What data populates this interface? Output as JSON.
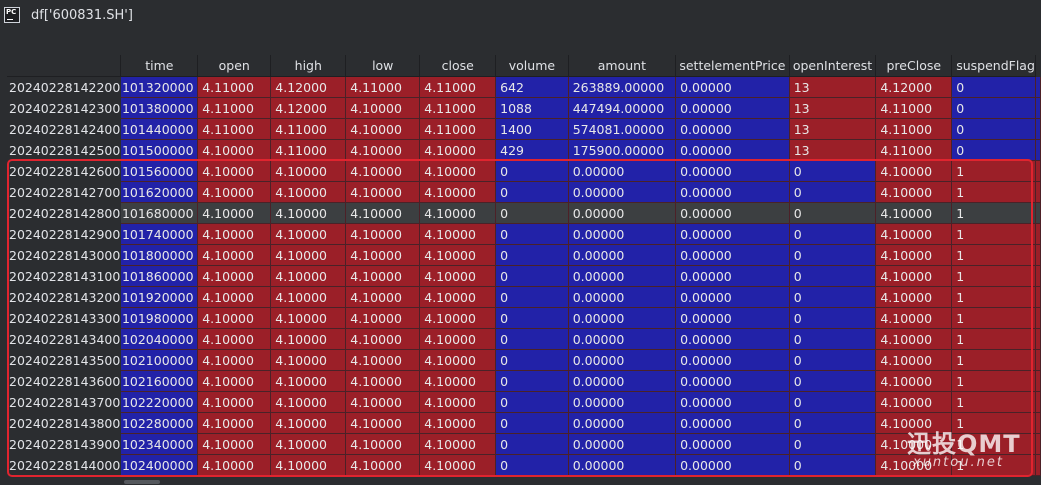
{
  "window": {
    "title": "df['600831.SH']"
  },
  "table": {
    "columns": [
      "time",
      "open",
      "high",
      "low",
      "close",
      "volume",
      "amount",
      "settelementPrice",
      "openInterest",
      "preClose",
      "suspendFlag"
    ],
    "rows": [
      {
        "index": "20240228142200",
        "time": "101320000",
        "open": "4.11000",
        "high": "4.12000",
        "low": "4.11000",
        "close": "4.11000",
        "volume": "642",
        "amount": "263889.00000",
        "settelementPrice": "0.00000",
        "openInterest": "13",
        "preClose": "4.12000",
        "suspendFlag": "0"
      },
      {
        "index": "20240228142300",
        "time": "101380000",
        "open": "4.11000",
        "high": "4.12000",
        "low": "4.10000",
        "close": "4.11000",
        "volume": "1088",
        "amount": "447494.00000",
        "settelementPrice": "0.00000",
        "openInterest": "13",
        "preClose": "4.11000",
        "suspendFlag": "0"
      },
      {
        "index": "20240228142400",
        "time": "101440000",
        "open": "4.11000",
        "high": "4.11000",
        "low": "4.10000",
        "close": "4.11000",
        "volume": "1400",
        "amount": "574081.00000",
        "settelementPrice": "0.00000",
        "openInterest": "13",
        "preClose": "4.11000",
        "suspendFlag": "0"
      },
      {
        "index": "20240228142500",
        "time": "101500000",
        "open": "4.10000",
        "high": "4.11000",
        "low": "4.10000",
        "close": "4.10000",
        "volume": "429",
        "amount": "175900.00000",
        "settelementPrice": "0.00000",
        "openInterest": "13",
        "preClose": "4.11000",
        "suspendFlag": "0"
      },
      {
        "index": "20240228142600",
        "time": "101560000",
        "open": "4.10000",
        "high": "4.10000",
        "low": "4.10000",
        "close": "4.10000",
        "volume": "0",
        "amount": "0.00000",
        "settelementPrice": "0.00000",
        "openInterest": "0",
        "preClose": "4.10000",
        "suspendFlag": "1"
      },
      {
        "index": "20240228142700",
        "time": "101620000",
        "open": "4.10000",
        "high": "4.10000",
        "low": "4.10000",
        "close": "4.10000",
        "volume": "0",
        "amount": "0.00000",
        "settelementPrice": "0.00000",
        "openInterest": "0",
        "preClose": "4.10000",
        "suspendFlag": "1"
      },
      {
        "index": "20240228142800",
        "time": "101680000",
        "open": "4.10000",
        "high": "4.10000",
        "low": "4.10000",
        "close": "4.10000",
        "volume": "0",
        "amount": "0.00000",
        "settelementPrice": "0.00000",
        "openInterest": "0",
        "preClose": "4.10000",
        "suspendFlag": "1",
        "selected": true
      },
      {
        "index": "20240228142900",
        "time": "101740000",
        "open": "4.10000",
        "high": "4.10000",
        "low": "4.10000",
        "close": "4.10000",
        "volume": "0",
        "amount": "0.00000",
        "settelementPrice": "0.00000",
        "openInterest": "0",
        "preClose": "4.10000",
        "suspendFlag": "1"
      },
      {
        "index": "20240228143000",
        "time": "101800000",
        "open": "4.10000",
        "high": "4.10000",
        "low": "4.10000",
        "close": "4.10000",
        "volume": "0",
        "amount": "0.00000",
        "settelementPrice": "0.00000",
        "openInterest": "0",
        "preClose": "4.10000",
        "suspendFlag": "1"
      },
      {
        "index": "20240228143100",
        "time": "101860000",
        "open": "4.10000",
        "high": "4.10000",
        "low": "4.10000",
        "close": "4.10000",
        "volume": "0",
        "amount": "0.00000",
        "settelementPrice": "0.00000",
        "openInterest": "0",
        "preClose": "4.10000",
        "suspendFlag": "1"
      },
      {
        "index": "20240228143200",
        "time": "101920000",
        "open": "4.10000",
        "high": "4.10000",
        "low": "4.10000",
        "close": "4.10000",
        "volume": "0",
        "amount": "0.00000",
        "settelementPrice": "0.00000",
        "openInterest": "0",
        "preClose": "4.10000",
        "suspendFlag": "1"
      },
      {
        "index": "20240228143300",
        "time": "101980000",
        "open": "4.10000",
        "high": "4.10000",
        "low": "4.10000",
        "close": "4.10000",
        "volume": "0",
        "amount": "0.00000",
        "settelementPrice": "0.00000",
        "openInterest": "0",
        "preClose": "4.10000",
        "suspendFlag": "1"
      },
      {
        "index": "20240228143400",
        "time": "102040000",
        "open": "4.10000",
        "high": "4.10000",
        "low": "4.10000",
        "close": "4.10000",
        "volume": "0",
        "amount": "0.00000",
        "settelementPrice": "0.00000",
        "openInterest": "0",
        "preClose": "4.10000",
        "suspendFlag": "1"
      },
      {
        "index": "20240228143500",
        "time": "102100000",
        "open": "4.10000",
        "high": "4.10000",
        "low": "4.10000",
        "close": "4.10000",
        "volume": "0",
        "amount": "0.00000",
        "settelementPrice": "0.00000",
        "openInterest": "0",
        "preClose": "4.10000",
        "suspendFlag": "1"
      },
      {
        "index": "20240228143600",
        "time": "102160000",
        "open": "4.10000",
        "high": "4.10000",
        "low": "4.10000",
        "close": "4.10000",
        "volume": "0",
        "amount": "0.00000",
        "settelementPrice": "0.00000",
        "openInterest": "0",
        "preClose": "4.10000",
        "suspendFlag": "1"
      },
      {
        "index": "20240228143700",
        "time": "102220000",
        "open": "4.10000",
        "high": "4.10000",
        "low": "4.10000",
        "close": "4.10000",
        "volume": "0",
        "amount": "0.00000",
        "settelementPrice": "0.00000",
        "openInterest": "0",
        "preClose": "4.10000",
        "suspendFlag": "1"
      },
      {
        "index": "20240228143800",
        "time": "102280000",
        "open": "4.10000",
        "high": "4.10000",
        "low": "4.10000",
        "close": "4.10000",
        "volume": "0",
        "amount": "0.00000",
        "settelementPrice": "0.00000",
        "openInterest": "0",
        "preClose": "4.10000",
        "suspendFlag": "1"
      },
      {
        "index": "20240228143900",
        "time": "102340000",
        "open": "4.10000",
        "high": "4.10000",
        "low": "4.10000",
        "close": "4.10000",
        "volume": "0",
        "amount": "0.00000",
        "settelementPrice": "0.00000",
        "openInterest": "0",
        "preClose": "4.10000",
        "suspendFlag": "1"
      },
      {
        "index": "20240228144000",
        "time": "102400000",
        "open": "4.10000",
        "high": "4.10000",
        "low": "4.10000",
        "close": "4.10000",
        "volume": "0",
        "amount": "0.00000",
        "settelementPrice": "0.00000",
        "openInterest": "0",
        "preClose": "4.10000",
        "suspendFlag": "1"
      }
    ]
  },
  "colors": {
    "red_cell": "#9b1f28",
    "blue_cell": "#2222a8",
    "selected_row": "#3c3f41",
    "highlight_border": "#e0242f"
  },
  "watermark": {
    "line1": "迅投QMT",
    "line2": "xuntou.net"
  }
}
